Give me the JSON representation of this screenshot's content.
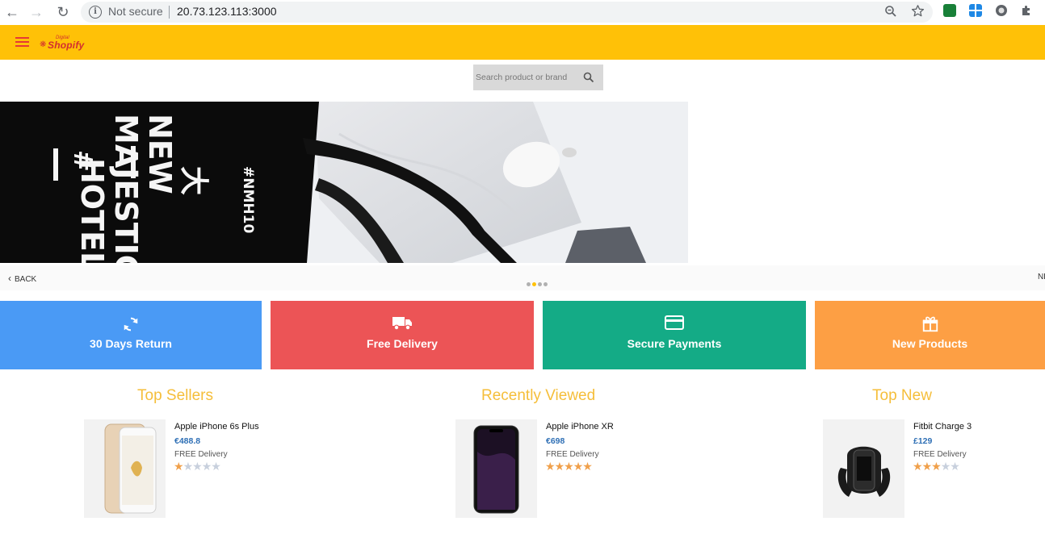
{
  "browser": {
    "status": "Not secure",
    "url": "20.73.123.113:3000"
  },
  "header": {
    "logo_small": "Digital",
    "logo_main": "Shopify"
  },
  "search": {
    "placeholder": "Search product or brand"
  },
  "carousel": {
    "back_label": "BACK",
    "next_label": "NEXT",
    "slide_count": 4,
    "active_slide": 2
  },
  "features": [
    {
      "label": "30 Days Return",
      "color": "#4a9af5",
      "icon": "refresh-icon"
    },
    {
      "label": "Free Delivery",
      "color": "#ec5456",
      "icon": "truck-icon"
    },
    {
      "label": "Secure Payments",
      "color": "#14ab86",
      "icon": "credit-card-icon"
    },
    {
      "label": "New Products",
      "color": "#fd9f44",
      "icon": "gift-icon"
    }
  ],
  "sections": [
    {
      "title": "Top Sellers",
      "product": {
        "name": "Apple iPhone 6s Plus",
        "price": "€488.8",
        "delivery": "FREE Delivery",
        "rating": 1,
        "max_rating": 5
      }
    },
    {
      "title": "Recently Viewed",
      "product": {
        "name": "Apple iPhone XR",
        "price": "€698",
        "delivery": "FREE Delivery",
        "rating": 5,
        "max_rating": 5
      }
    },
    {
      "title": "Top New",
      "product": {
        "name": "Fitbit Charge 3",
        "price": "£129",
        "delivery": "FREE Delivery",
        "rating": 3,
        "max_rating": 5
      }
    }
  ],
  "colors": {
    "app_bar": "#ffc107",
    "accent_red": "#e53935",
    "section_title": "#f5be3a",
    "price": "#2e6fb5"
  }
}
